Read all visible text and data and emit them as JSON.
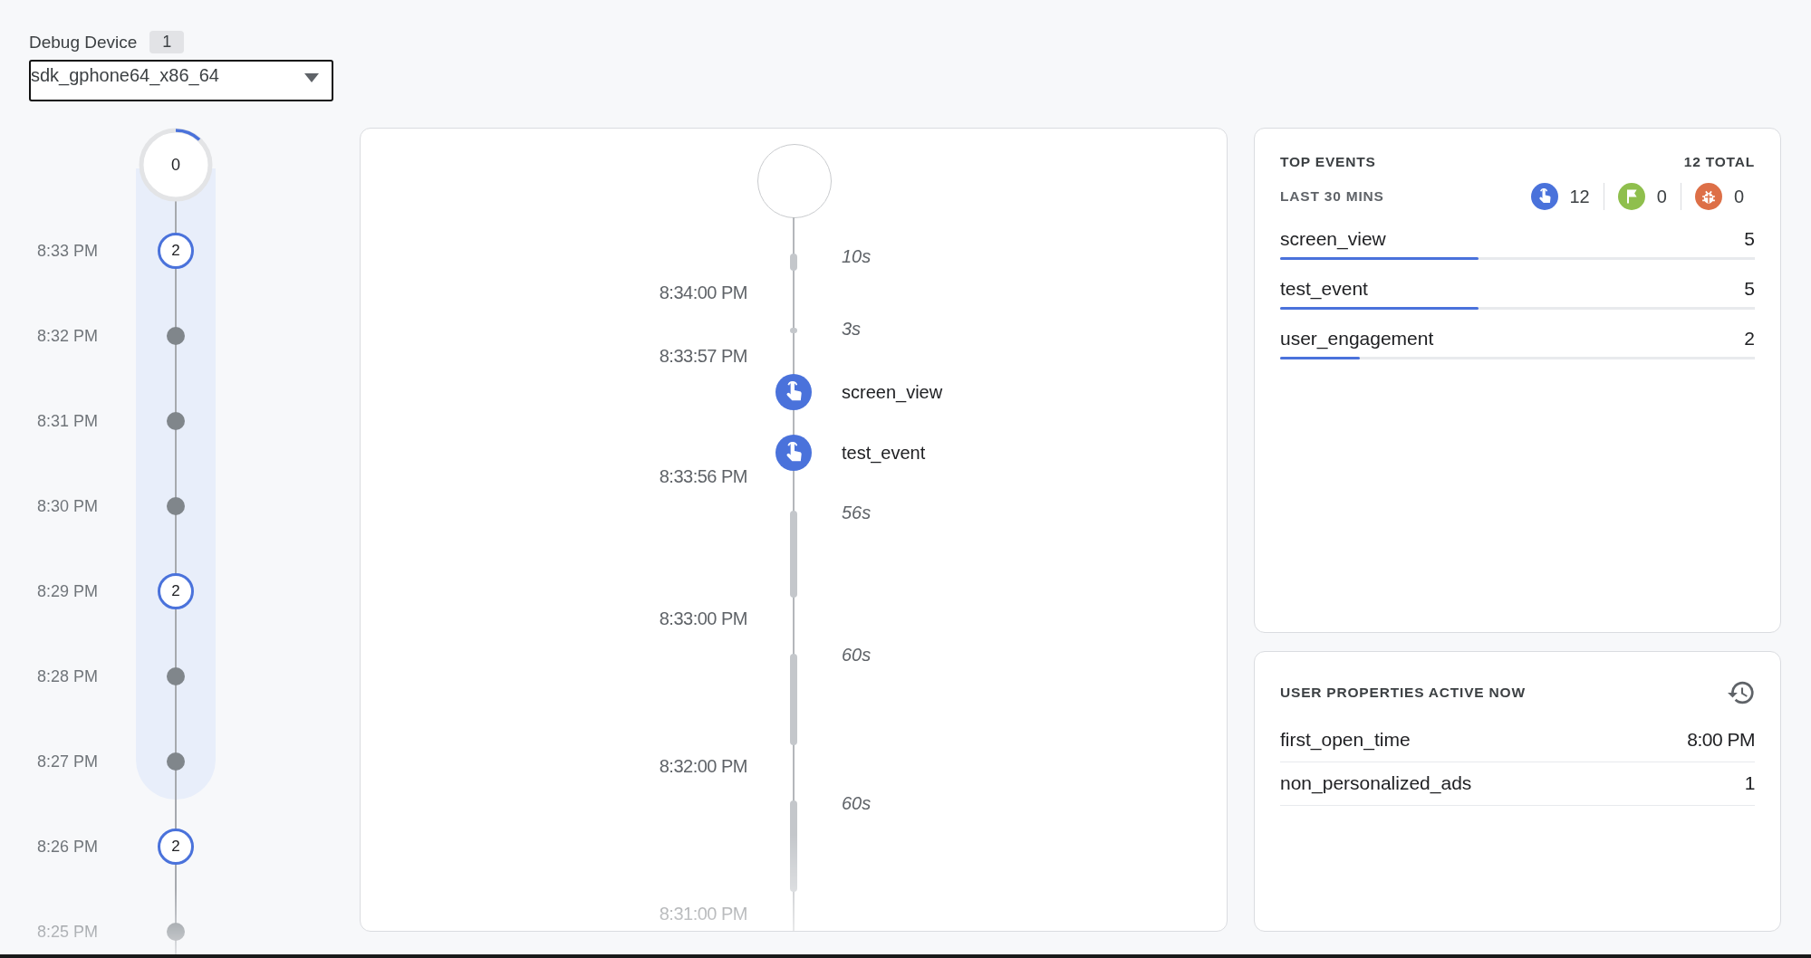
{
  "device": {
    "label": "Debug Device",
    "count": "1",
    "value": "sdk_gphone64_x86_64"
  },
  "minutes": {
    "current": {
      "count": "0",
      "level": 0.12
    },
    "rows": [
      {
        "time": "8:33 PM",
        "kind": "count",
        "count": "2"
      },
      {
        "time": "8:32 PM",
        "kind": "idle"
      },
      {
        "time": "8:31 PM",
        "kind": "idle"
      },
      {
        "time": "8:30 PM",
        "kind": "idle"
      },
      {
        "time": "8:29 PM",
        "kind": "count",
        "count": "2"
      },
      {
        "time": "8:28 PM",
        "kind": "idle"
      },
      {
        "time": "8:27 PM",
        "kind": "idle"
      },
      {
        "time": "8:26 PM",
        "kind": "count",
        "count": "2"
      },
      {
        "time": "8:25 PM",
        "kind": "idle"
      }
    ]
  },
  "stream": {
    "items": [
      {
        "kind": "duration",
        "label": "10s"
      },
      {
        "kind": "time",
        "label": "8:34:00 PM"
      },
      {
        "kind": "duration",
        "label": "3s"
      },
      {
        "kind": "time",
        "label": "8:33:57 PM"
      },
      {
        "kind": "event",
        "label": "screen_view"
      },
      {
        "kind": "event",
        "label": "test_event"
      },
      {
        "kind": "time",
        "label": "8:33:56 PM"
      },
      {
        "kind": "duration",
        "label": "56s"
      },
      {
        "kind": "time",
        "label": "8:33:00 PM"
      },
      {
        "kind": "duration",
        "label": "60s"
      },
      {
        "kind": "time",
        "label": "8:32:00 PM"
      },
      {
        "kind": "duration",
        "label": "60s"
      },
      {
        "kind": "time",
        "label": "8:31:00 PM"
      }
    ]
  },
  "top_events": {
    "title": "TOP EVENTS",
    "total": "12 TOTAL",
    "period": "LAST 30 MINS",
    "categories": [
      {
        "kind": "events",
        "count": "12",
        "color": "#4a72db"
      },
      {
        "kind": "conversions",
        "count": "0",
        "color": "#8fbf4d"
      },
      {
        "kind": "errors",
        "count": "0",
        "color": "#dd6f47"
      }
    ],
    "rows": [
      {
        "name": "screen_view",
        "count": "5",
        "level": 0.417
      },
      {
        "name": "test_event",
        "count": "5",
        "level": 0.417
      },
      {
        "name": "user_engagement",
        "count": "2",
        "level": 0.167
      }
    ]
  },
  "user_properties": {
    "title": "USER PROPERTIES ACTIVE NOW",
    "rows": [
      {
        "name": "first_open_time",
        "value": "8:00 PM"
      },
      {
        "name": "non_personalized_ads",
        "value": "1"
      }
    ]
  }
}
